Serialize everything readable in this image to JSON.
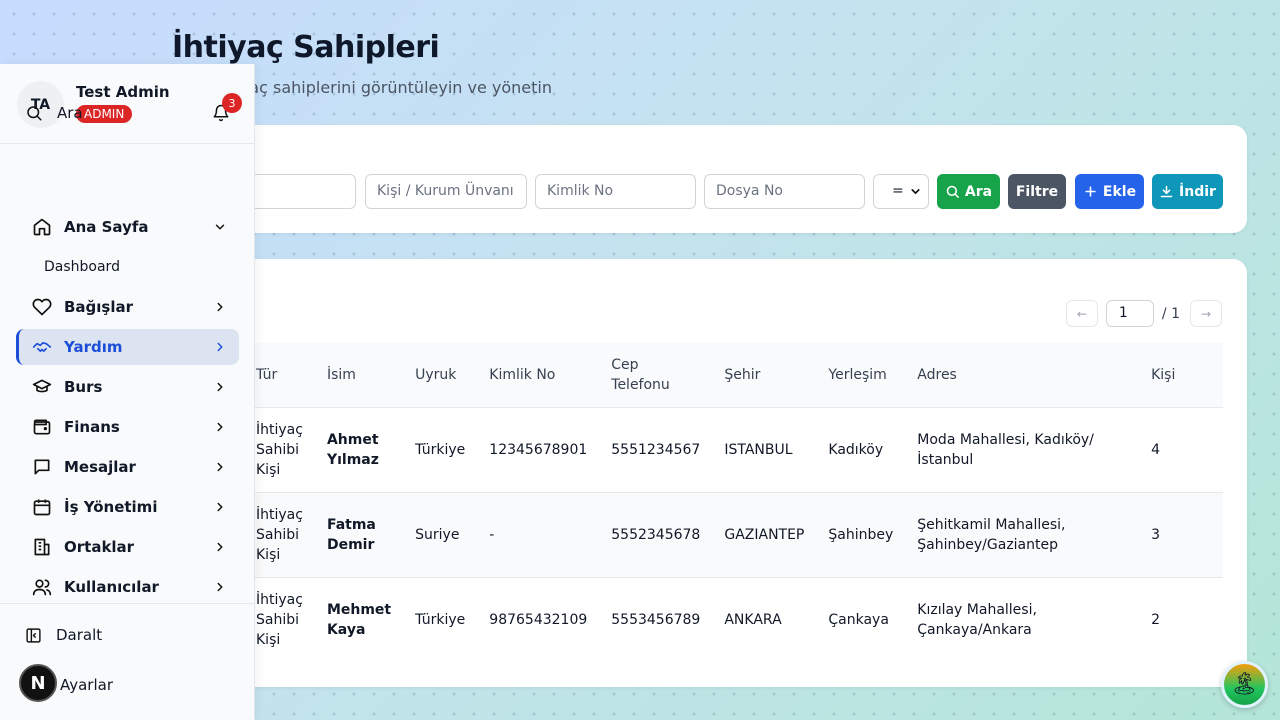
{
  "page": {
    "title": "İhtiyaç Sahipleri",
    "subtitle": "aç sahiplerini görüntüleyin ve yönetin"
  },
  "filters": {
    "person_placeholder": "Kişi / Kurum Ünvanı",
    "id_placeholder": "Kimlik No",
    "file_placeholder": "Dosya No",
    "operator_value": "=",
    "search_label": "Ara",
    "filter_label": "Filtre",
    "add_label": "Ekle",
    "download_label": "İndir"
  },
  "pagination": {
    "prev": "←",
    "next": "→",
    "current": "1",
    "total": "/ 1"
  },
  "table": {
    "headers": [
      "Tür",
      "İsim",
      "Uyruk",
      "Kimlik No",
      "Cep Telefonu",
      "Şehir",
      "Yerleşim",
      "Adres",
      "Kişi"
    ],
    "rows": [
      [
        "İhtiyaç Sahibi Kişi",
        "Ahmet Yılmaz",
        "Türkiye",
        "12345678901",
        "5551234567",
        "ISTANBUL",
        "Kadıköy",
        "Moda Mahallesi, Kadıköy/İstanbul",
        "4"
      ],
      [
        "İhtiyaç Sahibi Kişi",
        "Fatma Demir",
        "Suriye",
        "-",
        "5552345678",
        "GAZIANTEP",
        "Şahinbey",
        "Şehitkamil Mahallesi, Şahinbey/Gaziantep",
        "3"
      ],
      [
        "İhtiyaç Sahibi Kişi",
        "Mehmet Kaya",
        "Türkiye",
        "98765432109",
        "5553456789",
        "ANKARA",
        "Çankaya",
        "Kızılay Mahallesi, Çankaya/Ankara",
        "2"
      ]
    ]
  },
  "sidebar": {
    "initials": "TA",
    "user_name": "Test Admin",
    "role": "ADMIN",
    "search_label": "Ara",
    "notification_count": "3",
    "nav": [
      {
        "label": "Ana Sayfa",
        "icon": "home-icon",
        "expanded": true
      },
      {
        "label": "Bağışlar",
        "icon": "heart-icon"
      },
      {
        "label": "Yardım",
        "icon": "handshake-icon",
        "active": true
      },
      {
        "label": "Burs",
        "icon": "graduation-cap-icon"
      },
      {
        "label": "Finans",
        "icon": "wallet-icon"
      },
      {
        "label": "Mesajlar",
        "icon": "message-icon"
      },
      {
        "label": "İş Yönetimi",
        "icon": "calendar-icon"
      },
      {
        "label": "Ortaklar",
        "icon": "building-icon"
      },
      {
        "label": "Kullanıcılar",
        "icon": "users-icon"
      }
    ],
    "sub_item": "Dashboard",
    "collapse_label": "Daralt",
    "settings_label": "Ayarlar"
  },
  "overlay": {
    "n_badge": "N"
  },
  "colors": {
    "accent_blue": "#2563eb",
    "success": "#16a34a",
    "danger": "#dc2626",
    "teal": "#0e97b8"
  }
}
